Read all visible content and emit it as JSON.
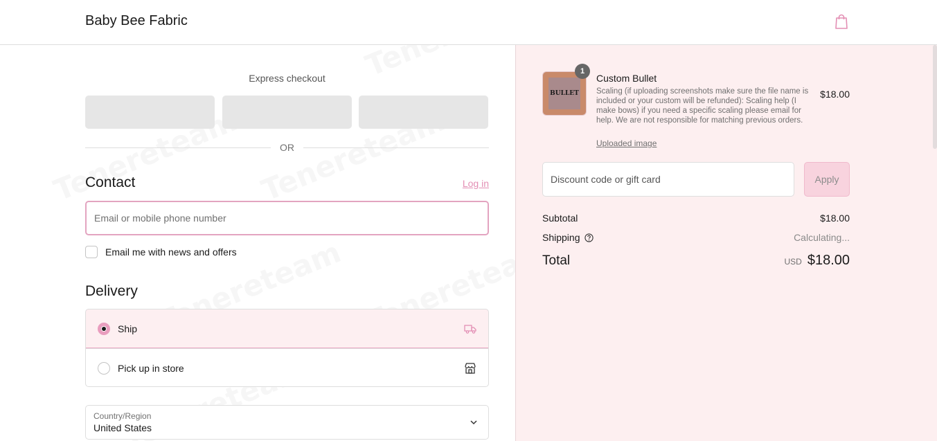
{
  "header": {
    "brand": "Baby Bee Fabric",
    "cart_icon": "shopping-bag-icon"
  },
  "express": {
    "title": "Express checkout",
    "or_label": "OR"
  },
  "contact": {
    "heading": "Contact",
    "login_label": "Log in",
    "email_placeholder": "Email or mobile phone number",
    "newsletter_label": "Email me with news and offers",
    "newsletter_checked": false
  },
  "delivery": {
    "heading": "Delivery",
    "options": [
      {
        "label": "Ship",
        "icon": "truck-icon",
        "selected": true
      },
      {
        "label": "Pick up in store",
        "icon": "store-icon",
        "selected": false
      }
    ],
    "country_label": "Country/Region",
    "country_value": "United States"
  },
  "order": {
    "item": {
      "quantity": "1",
      "thumb_text": "BULLET",
      "name": "Custom Bullet",
      "description": "Scaling (if uploading screenshots make sure the file name is included or your custom will be refunded): Scaling help (I make bows) if you need a specific scaling please email for help. We are not responsible for matching previous orders.",
      "link_label": "Uploaded image",
      "price": "$18.00"
    },
    "discount_placeholder": "Discount code or gift card",
    "apply_label": "Apply",
    "subtotal_label": "Subtotal",
    "subtotal_value": "$18.00",
    "shipping_label": "Shipping",
    "shipping_value": "Calculating...",
    "total_label": "Total",
    "currency": "USD",
    "total_value": "$18.00"
  },
  "colors": {
    "accent": "#e38fb4",
    "sidebar_bg": "#fdeff0",
    "apply_bg": "#f8d3de"
  }
}
